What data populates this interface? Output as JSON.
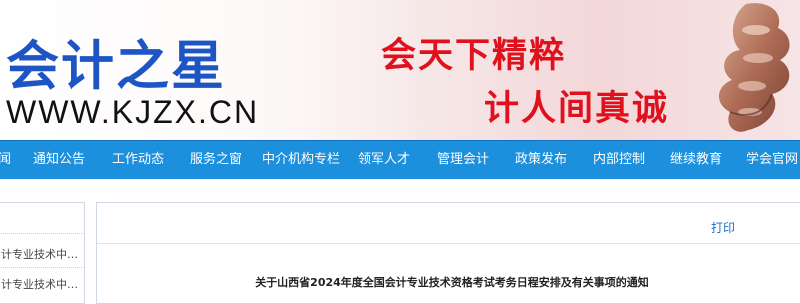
{
  "header": {
    "logo_text": "会计之星",
    "logo_url": "WWW.KJZX.CN",
    "slogan_line1": "会天下精粹",
    "slogan_line2": "计人间真诚"
  },
  "nav": {
    "items": [
      {
        "label": "闻"
      },
      {
        "label": "通知公告"
      },
      {
        "label": "工作动态"
      },
      {
        "label": "服务之窗"
      },
      {
        "label": "中介机构专栏"
      },
      {
        "label": "领军人才"
      },
      {
        "label": "管理会计"
      },
      {
        "label": "政策发布"
      },
      {
        "label": "内部控制"
      },
      {
        "label": "继续教育"
      },
      {
        "label": "学会官网"
      }
    ]
  },
  "sidebar": {
    "links": [
      {
        "label": "计专业技术中级..."
      },
      {
        "label": "计专业技术中级..."
      }
    ]
  },
  "content": {
    "print_label": "打印",
    "title": "关于山西省2024年度全国会计专业技术资格考试考务日程安排及有关事项的通知"
  },
  "colors": {
    "brand_blue": "#1d56c4",
    "nav_blue": "#1c8fdd",
    "slogan_red": "#e0101d"
  }
}
